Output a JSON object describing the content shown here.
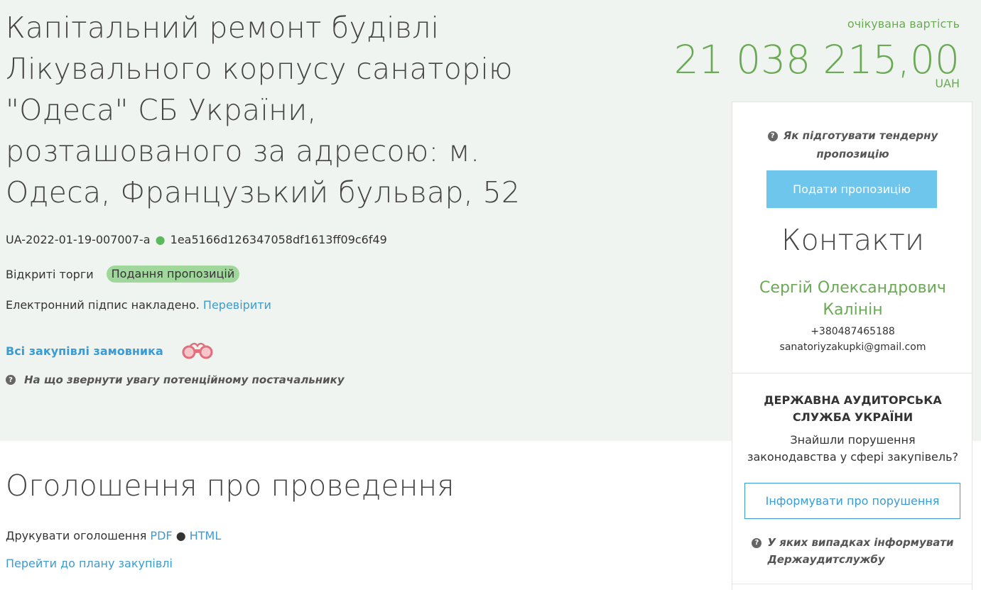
{
  "tender": {
    "title": "Капітальний ремонт будівлі Лікувального корпусу санаторію \"Одеса\" СБ України, розташованого за адресою: м. Одеса, Французький бульвар, 52",
    "id": "UA-2022-01-19-007007-a",
    "separator": "●",
    "hash": "1ea5166d126347058df1613ff09c6f49",
    "procedure_type": "Відкриті торги",
    "status": "Подання пропозицій",
    "signature_text": "Електронний підпис накладено.",
    "signature_link": "Перевірити",
    "customer_link": "Всі закупівлі замовника",
    "supplier_hint": "На що звернути увагу потенційному постачальнику"
  },
  "price": {
    "label": "очікувана вартість",
    "amount": "21 038 215,00",
    "currency": "UAH"
  },
  "announcement": {
    "title": "Оголошення про проведення",
    "print_label": "Друкувати оголошення",
    "pdf_link": "PDF",
    "separator": "●",
    "html_link": "HTML",
    "plan_link": "Перейти до плану закупівлі"
  },
  "sidebar": {
    "prepare_hint_line1": "Як підготувати тендерну",
    "prepare_hint_line2": "пропозицію",
    "submit_button": "Подати пропозицію",
    "contacts_title": "Контакти",
    "contact_name_line1": "Сергій Олександрович",
    "contact_name_line2": "Калінін",
    "contact_phone": "+380487465188",
    "contact_email": "sanatoriyzakupki@gmail.com",
    "audit_title_line1": "ДЕРЖАВНА АУДИТОРСЬКА",
    "audit_title_line2": "СЛУЖБА УКРАЇНИ",
    "audit_question_line1": "Знайшли порушення",
    "audit_question_line2": "законодавства у сфері закупівель?",
    "inform_button": "Інформувати про порушення",
    "audit_hint_line1": "У яких випадках інформувати",
    "audit_hint_line2": "Держаудитслужбу"
  },
  "icons": {
    "help": "question-circle-icon",
    "binoculars": "binoculars-icon"
  },
  "colors": {
    "accent_green": "#6aaa55",
    "link_blue": "#3a9bd5",
    "submit_button": "#6ec6ec",
    "status_badge": "#9fd89a",
    "header_background": "#f0f4f0"
  }
}
